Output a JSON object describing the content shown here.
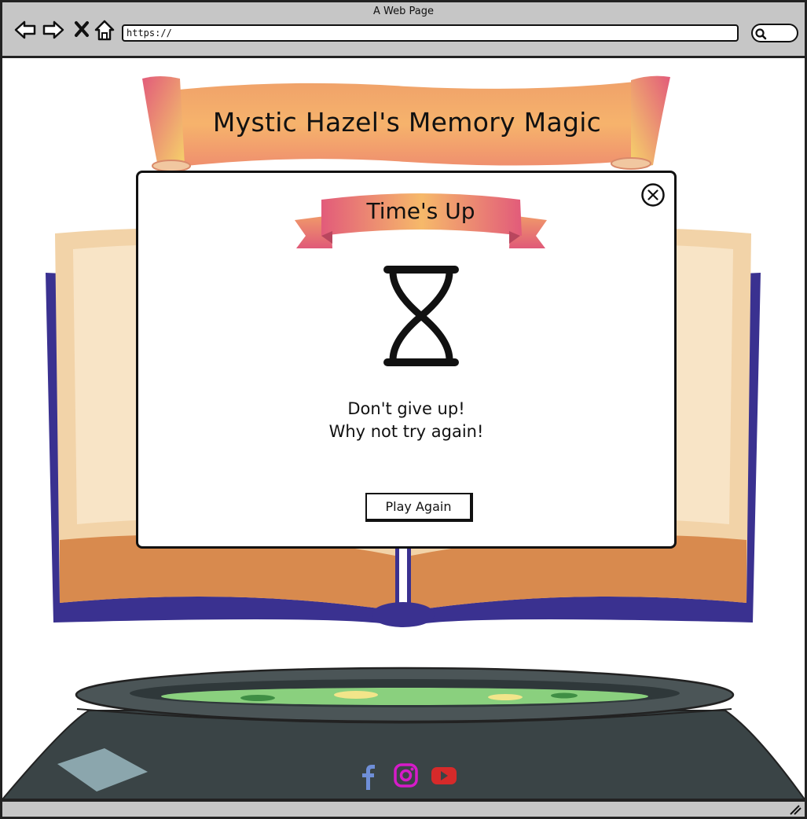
{
  "browser": {
    "window_title": "A Web Page",
    "url": "https://",
    "icons": [
      "back-arrow-icon",
      "forward-arrow-icon",
      "close-x-icon",
      "home-icon",
      "search-icon",
      "resize-grip-icon"
    ]
  },
  "page": {
    "banner_title": "Mystic Hazel's Memory Magic"
  },
  "modal": {
    "title": "Time's Up",
    "icon": "hourglass-icon",
    "message_line1": "Don't give up!",
    "message_line2": "Why not try again!",
    "button_label": "Play Again",
    "close_icon": "close-circle-icon"
  },
  "footer": {
    "social": [
      {
        "name": "facebook",
        "icon": "facebook-icon",
        "color": "#6f8fd8"
      },
      {
        "name": "instagram",
        "icon": "instagram-icon",
        "color": "#d61bc9"
      },
      {
        "name": "youtube",
        "icon": "youtube-icon",
        "color": "#d62a2a"
      }
    ]
  },
  "colors": {
    "banner_gradient_start": "#e8544f",
    "banner_gradient_end": "#f7c85a",
    "book_cover": "#3a3190",
    "book_page": "#f2d3a8",
    "cauldron": "#3c4446",
    "potion": "#8ad07e"
  }
}
